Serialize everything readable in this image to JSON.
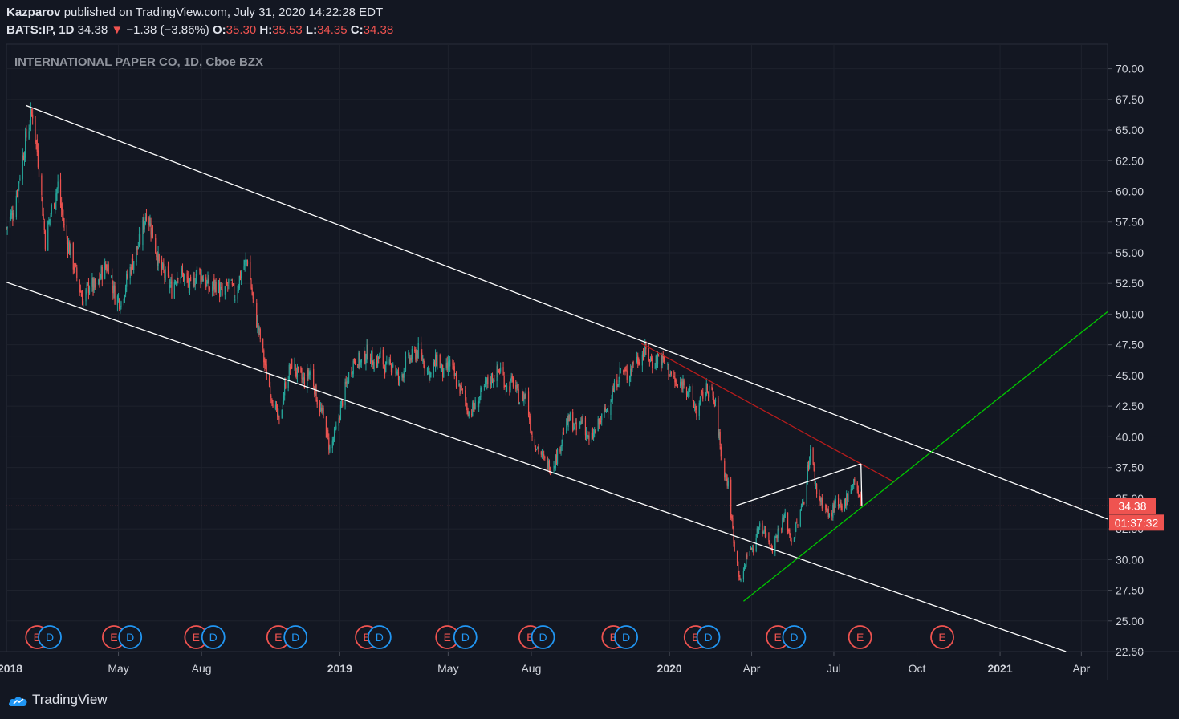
{
  "header": {
    "author": "Kazparov",
    "published_text": "published on TradingView.com, July 31, 2020 14:22:28 EDT",
    "symbol": "BATS:IP, 1D",
    "last": "34.38",
    "down_arrow": "▼",
    "change": "−1.38 (−3.86%)",
    "o_label": "O:",
    "o_value": "35.30",
    "h_label": "H:",
    "h_value": "35.53",
    "l_label": "L:",
    "l_value": "34.35",
    "c_label": "C:",
    "c_value": "34.38"
  },
  "footer": {
    "brand": "TradingView",
    "logo_icon": "tradingview-logo-icon"
  },
  "chart_data": {
    "type": "candlestick",
    "title": "INTERNATIONAL PAPER CO, 1D, Cboe BZX",
    "x_range": [
      "2017-12-28",
      "2021-04-30"
    ],
    "y_range": [
      22.5,
      72
    ],
    "y_ticks": [
      70.0,
      67.5,
      65.0,
      62.5,
      60.0,
      57.5,
      55.0,
      52.5,
      50.0,
      47.5,
      45.0,
      42.5,
      40.0,
      37.5,
      35.0,
      32.5,
      30.0,
      27.5,
      25.0,
      22.5
    ],
    "x_ticks": [
      {
        "date": "2018-01-01",
        "label": "2018",
        "bold": true
      },
      {
        "date": "2018-05-01",
        "label": "May",
        "bold": false
      },
      {
        "date": "2018-08-01",
        "label": "Aug",
        "bold": false
      },
      {
        "date": "2019-01-01",
        "label": "2019",
        "bold": true
      },
      {
        "date": "2019-05-01",
        "label": "May",
        "bold": false
      },
      {
        "date": "2019-08-01",
        "label": "Aug",
        "bold": false
      },
      {
        "date": "2020-01-01",
        "label": "2020",
        "bold": true
      },
      {
        "date": "2020-04-01",
        "label": "Apr",
        "bold": false
      },
      {
        "date": "2020-07-01",
        "label": "Jul",
        "bold": false
      },
      {
        "date": "2020-10-01",
        "label": "Oct",
        "bold": false
      },
      {
        "date": "2021-01-01",
        "label": "2021",
        "bold": true
      },
      {
        "date": "2021-04-01",
        "label": "Apr",
        "bold": false
      }
    ],
    "price_path": [
      [
        "2017-12-28",
        57.0
      ],
      [
        "2018-01-05",
        58.5
      ],
      [
        "2018-01-12",
        61.5
      ],
      [
        "2018-01-19",
        64.5
      ],
      [
        "2018-01-26",
        66.5
      ],
      [
        "2018-02-02",
        62.0
      ],
      [
        "2018-02-09",
        56.0
      ],
      [
        "2018-02-16",
        58.5
      ],
      [
        "2018-02-23",
        60.5
      ],
      [
        "2018-03-02",
        57.0
      ],
      [
        "2018-03-09",
        55.0
      ],
      [
        "2018-03-16",
        53.0
      ],
      [
        "2018-03-23",
        51.0
      ],
      [
        "2018-03-30",
        52.5
      ],
      [
        "2018-04-06",
        52.0
      ],
      [
        "2018-04-13",
        53.5
      ],
      [
        "2018-04-20",
        54.0
      ],
      [
        "2018-04-27",
        51.5
      ],
      [
        "2018-05-04",
        51.0
      ],
      [
        "2018-05-11",
        53.0
      ],
      [
        "2018-05-18",
        54.5
      ],
      [
        "2018-05-25",
        56.0
      ],
      [
        "2018-06-01",
        58.5
      ],
      [
        "2018-06-08",
        56.5
      ],
      [
        "2018-06-15",
        54.0
      ],
      [
        "2018-06-22",
        53.0
      ],
      [
        "2018-06-29",
        52.0
      ],
      [
        "2018-07-06",
        53.5
      ],
      [
        "2018-07-13",
        53.0
      ],
      [
        "2018-07-20",
        52.0
      ],
      [
        "2018-07-27",
        53.5
      ],
      [
        "2018-08-03",
        53.0
      ],
      [
        "2018-08-10",
        52.0
      ],
      [
        "2018-08-17",
        52.5
      ],
      [
        "2018-08-24",
        51.5
      ],
      [
        "2018-08-31",
        52.5
      ],
      [
        "2018-09-07",
        51.5
      ],
      [
        "2018-09-14",
        53.5
      ],
      [
        "2018-09-21",
        54.5
      ],
      [
        "2018-09-28",
        50.5
      ],
      [
        "2018-10-05",
        48.0
      ],
      [
        "2018-10-12",
        45.0
      ],
      [
        "2018-10-19",
        43.0
      ],
      [
        "2018-10-26",
        41.0
      ],
      [
        "2018-11-02",
        44.5
      ],
      [
        "2018-11-09",
        46.0
      ],
      [
        "2018-11-16",
        45.0
      ],
      [
        "2018-11-23",
        44.5
      ],
      [
        "2018-11-30",
        45.5
      ],
      [
        "2018-12-07",
        43.0
      ],
      [
        "2018-12-14",
        41.5
      ],
      [
        "2018-12-21",
        39.0
      ],
      [
        "2018-12-28",
        40.5
      ],
      [
        "2019-01-04",
        43.0
      ],
      [
        "2019-01-11",
        45.0
      ],
      [
        "2019-01-18",
        46.5
      ],
      [
        "2019-01-25",
        46.0
      ],
      [
        "2019-02-01",
        47.0
      ],
      [
        "2019-02-08",
        46.0
      ],
      [
        "2019-02-15",
        46.5
      ],
      [
        "2019-02-22",
        45.5
      ],
      [
        "2019-03-01",
        46.0
      ],
      [
        "2019-03-08",
        44.5
      ],
      [
        "2019-03-15",
        46.0
      ],
      [
        "2019-03-22",
        46.5
      ],
      [
        "2019-03-29",
        47.0
      ],
      [
        "2019-04-05",
        46.0
      ],
      [
        "2019-04-12",
        45.0
      ],
      [
        "2019-04-19",
        46.5
      ],
      [
        "2019-04-26",
        45.0
      ],
      [
        "2019-05-03",
        46.0
      ],
      [
        "2019-05-10",
        44.5
      ],
      [
        "2019-05-17",
        43.5
      ],
      [
        "2019-05-24",
        42.0
      ],
      [
        "2019-05-31",
        42.5
      ],
      [
        "2019-06-07",
        43.5
      ],
      [
        "2019-06-14",
        44.5
      ],
      [
        "2019-06-21",
        45.0
      ],
      [
        "2019-06-28",
        45.5
      ],
      [
        "2019-07-05",
        44.0
      ],
      [
        "2019-07-12",
        44.5
      ],
      [
        "2019-07-19",
        43.0
      ],
      [
        "2019-07-26",
        43.5
      ],
      [
        "2019-08-02",
        40.0
      ],
      [
        "2019-08-09",
        39.0
      ],
      [
        "2019-08-16",
        38.0
      ],
      [
        "2019-08-23",
        37.5
      ],
      [
        "2019-08-30",
        38.5
      ],
      [
        "2019-09-06",
        40.5
      ],
      [
        "2019-09-13",
        41.5
      ],
      [
        "2019-09-20",
        40.5
      ],
      [
        "2019-09-27",
        41.5
      ],
      [
        "2019-10-04",
        39.5
      ],
      [
        "2019-10-11",
        40.5
      ],
      [
        "2019-10-18",
        41.5
      ],
      [
        "2019-10-25",
        42.5
      ],
      [
        "2019-11-01",
        44.0
      ],
      [
        "2019-11-08",
        45.5
      ],
      [
        "2019-11-15",
        45.0
      ],
      [
        "2019-11-22",
        46.0
      ],
      [
        "2019-11-29",
        46.5
      ],
      [
        "2019-12-06",
        47.0
      ],
      [
        "2019-12-13",
        46.0
      ],
      [
        "2019-12-20",
        46.5
      ],
      [
        "2019-12-27",
        46.0
      ],
      [
        "2020-01-03",
        45.0
      ],
      [
        "2020-01-10",
        44.0
      ],
      [
        "2020-01-17",
        44.5
      ],
      [
        "2020-01-24",
        43.5
      ],
      [
        "2020-01-31",
        42.0
      ],
      [
        "2020-02-07",
        43.5
      ],
      [
        "2020-02-14",
        44.0
      ],
      [
        "2020-02-21",
        42.5
      ],
      [
        "2020-02-28",
        38.0
      ],
      [
        "2020-03-06",
        36.0
      ],
      [
        "2020-03-13",
        31.0
      ],
      [
        "2020-03-20",
        28.0
      ],
      [
        "2020-03-27",
        30.5
      ],
      [
        "2020-04-03",
        31.0
      ],
      [
        "2020-04-10",
        33.0
      ],
      [
        "2020-04-17",
        32.0
      ],
      [
        "2020-04-24",
        31.0
      ],
      [
        "2020-05-01",
        32.5
      ],
      [
        "2020-05-08",
        33.5
      ],
      [
        "2020-05-15",
        31.5
      ],
      [
        "2020-05-22",
        33.0
      ],
      [
        "2020-05-29",
        35.0
      ],
      [
        "2020-06-05",
        39.0
      ],
      [
        "2020-06-12",
        35.5
      ],
      [
        "2020-06-19",
        34.5
      ],
      [
        "2020-06-26",
        33.5
      ],
      [
        "2020-07-03",
        34.5
      ],
      [
        "2020-07-10",
        34.0
      ],
      [
        "2020-07-17",
        35.5
      ],
      [
        "2020-07-24",
        36.5
      ],
      [
        "2020-07-31",
        34.38
      ]
    ],
    "drawings": [
      {
        "name": "channel-upper-line",
        "color": "#ffffff",
        "points": [
          [
            "2018-01-19",
            67.0
          ],
          [
            "2021-04-30",
            33.3
          ]
        ]
      },
      {
        "name": "channel-lower-line",
        "color": "#ffffff",
        "points": [
          [
            "2017-12-28",
            52.6
          ],
          [
            "2021-03-15",
            22.5
          ]
        ]
      },
      {
        "name": "red-trend-line",
        "color": "#b71c1c",
        "points": [
          [
            "2019-12-01",
            47.6
          ],
          [
            "2020-09-06",
            36.3
          ]
        ]
      },
      {
        "name": "green-trend-line",
        "color": "#00c800",
        "points": [
          [
            "2020-03-23",
            26.6
          ],
          [
            "2021-04-30",
            50.2
          ]
        ]
      },
      {
        "name": "wedge-upper-line",
        "color": "#ffffff",
        "points": [
          [
            "2020-03-15",
            34.4
          ],
          [
            "2020-07-31",
            37.8
          ]
        ]
      },
      {
        "name": "wedge-close-line",
        "color": "#ffffff",
        "points": [
          [
            "2020-07-31",
            37.8
          ],
          [
            "2020-08-01",
            34.4
          ]
        ]
      }
    ],
    "last_price": {
      "value": "34.38",
      "countdown": "01:37:32",
      "color": "#ef5350"
    },
    "events": [
      {
        "type": "E",
        "date": "2018-01-31"
      },
      {
        "type": "D",
        "date": "2018-02-14"
      },
      {
        "type": "E",
        "date": "2018-04-26"
      },
      {
        "type": "D",
        "date": "2018-05-14"
      },
      {
        "type": "E",
        "date": "2018-07-26"
      },
      {
        "type": "D",
        "date": "2018-08-14"
      },
      {
        "type": "E",
        "date": "2018-10-25"
      },
      {
        "type": "D",
        "date": "2018-11-13"
      },
      {
        "type": "E",
        "date": "2019-01-31"
      },
      {
        "type": "D",
        "date": "2019-02-14"
      },
      {
        "type": "E",
        "date": "2019-04-30"
      },
      {
        "type": "D",
        "date": "2019-05-20"
      },
      {
        "type": "E",
        "date": "2019-07-31"
      },
      {
        "type": "D",
        "date": "2019-08-14"
      },
      {
        "type": "E",
        "date": "2019-10-31"
      },
      {
        "type": "D",
        "date": "2019-11-14"
      },
      {
        "type": "E",
        "date": "2020-01-30"
      },
      {
        "type": "D",
        "date": "2020-02-13"
      },
      {
        "type": "E",
        "date": "2020-04-30"
      },
      {
        "type": "D",
        "date": "2020-05-18"
      },
      {
        "type": "E",
        "date": "2020-07-30"
      },
      {
        "type": "E",
        "date": "2020-10-29"
      }
    ],
    "colors": {
      "up": "#26a69a",
      "down": "#ef5350",
      "background": "#131722",
      "grid": "#1e222d",
      "axis_text": "#d1d4dc",
      "event_e": "#ef5350",
      "event_d": "#2196f3"
    }
  }
}
